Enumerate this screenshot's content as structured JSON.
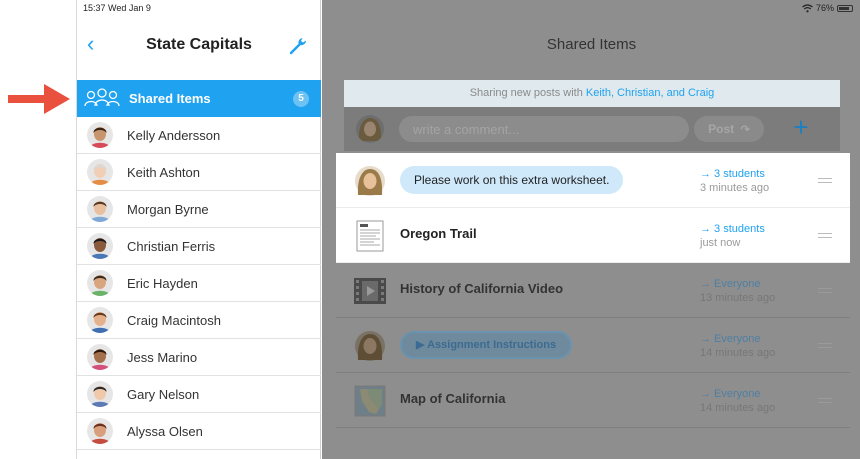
{
  "status_bar": {
    "time_date": "15:37  Wed Jan 9",
    "battery": "76%"
  },
  "sidebar": {
    "title": "State Capitals",
    "shared": {
      "label": "Shared Items",
      "badge": "5"
    },
    "students": [
      {
        "name": "Kelly Andersson",
        "skin": "#c8966e",
        "hair": "#3b2314",
        "shirt": "#d74a59"
      },
      {
        "name": "Keith Ashton",
        "skin": "#f0cfb6",
        "hair": "#d9d9d9",
        "shirt": "#e68d45"
      },
      {
        "name": "Morgan Byrne",
        "skin": "#e8c0a0",
        "hair": "#5a3a22",
        "shirt": "#7fa8d6"
      },
      {
        "name": "Christian Ferris",
        "skin": "#8a5a3c",
        "hair": "#1a1a1a",
        "shirt": "#4a77b5"
      },
      {
        "name": "Eric Hayden",
        "skin": "#d9a57f",
        "hair": "#3a2a1c",
        "shirt": "#6bb36a"
      },
      {
        "name": "Craig Macintosh",
        "skin": "#e5b08c",
        "hair": "#6a3a1d",
        "shirt": "#3f6fb0"
      },
      {
        "name": "Jess Marino",
        "skin": "#a4704b",
        "hair": "#2a1a10",
        "shirt": "#d44f7a"
      },
      {
        "name": "Gary Nelson",
        "skin": "#f0c8aa",
        "hair": "#2a2a2a",
        "shirt": "#5c7ab5"
      },
      {
        "name": "Alyssa Olsen",
        "skin": "#d99e7a",
        "hair": "#6a2e1c",
        "shirt": "#c44d3f"
      }
    ]
  },
  "main": {
    "title": "Shared Items",
    "banner_prefix": "Sharing new posts with ",
    "banner_names": "Keith, Christian, and Craig",
    "compose_placeholder": "write a comment...",
    "post_label": "Post",
    "plus_label": "+",
    "feed": [
      {
        "kind": "message",
        "text": "Please work on this extra worksheet.",
        "to": "→ 3 students",
        "time": "3 minutes ago",
        "highlight": true
      },
      {
        "kind": "document",
        "text": "Oregon Trail",
        "to": "→ 3 students",
        "time": "just now",
        "highlight": true
      },
      {
        "kind": "video",
        "text": "History of California Video",
        "to": "→ Everyone",
        "time": "13 minutes ago",
        "highlight": false
      },
      {
        "kind": "audio",
        "text": "▶ Assignment Instructions",
        "to": "→ Everyone",
        "time": "14 minutes ago",
        "highlight": false
      },
      {
        "kind": "map",
        "text": "Map of California",
        "to": "→ Everyone",
        "time": "14 minutes ago",
        "highlight": false
      }
    ]
  },
  "colors": {
    "accent": "#1fa2ef",
    "pointer": "#e9503e",
    "dim_overlay": "#8e8e8e"
  }
}
